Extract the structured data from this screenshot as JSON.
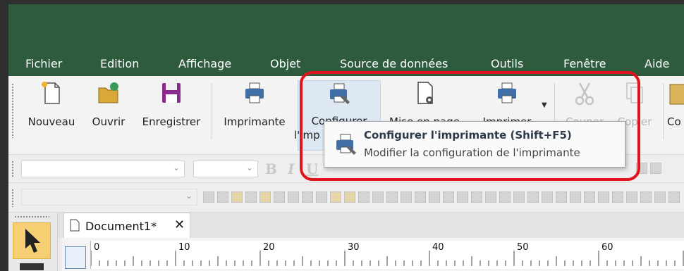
{
  "menu": [
    "Fichier",
    "Edition",
    "Affichage",
    "Objet",
    "Source de données",
    "Outils",
    "Fenêtre",
    "Aide"
  ],
  "toolbar": {
    "new_label": "Nouveau",
    "open_label": "Ouvrir",
    "save_label": "Enregistrer",
    "printer_label": "Imprimante",
    "configure_label_1": "Configurer",
    "configure_label_2": "l'imp",
    "pagesetup_label": "Mise en page",
    "print_label": "Imprimer",
    "cut_label": "Couper",
    "copy_label": "Copier",
    "paste_label": "Co"
  },
  "format": {
    "bold": "B",
    "italic": "I",
    "underline": "U"
  },
  "tooltip": {
    "title": "Configurer l'imprimante  (Shift+F5)",
    "description": "Modifier la configuration de l'imprimante"
  },
  "document": {
    "tab_title": "Document1*",
    "close_symbol": "✕"
  },
  "ruler": [
    "0",
    "10",
    "20",
    "30",
    "40",
    "50",
    "60"
  ],
  "colors": {
    "title_bar": "#2e5a3e",
    "highlight_outline": "#e1141b",
    "active_tool": "#f6cf73"
  }
}
